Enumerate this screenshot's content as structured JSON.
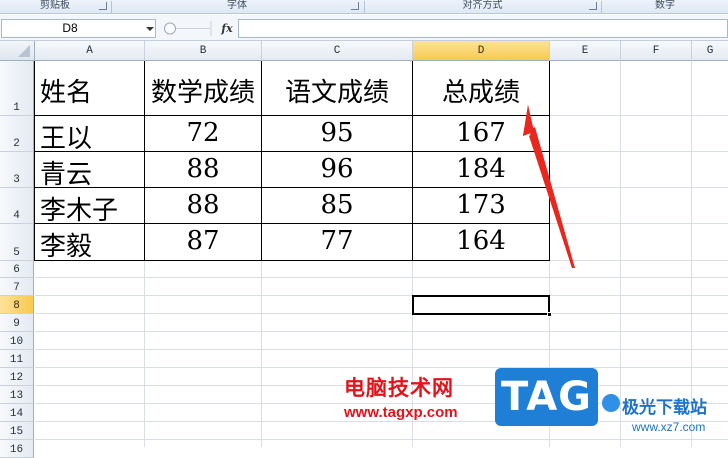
{
  "ribbon": {
    "groups": [
      "剪贴板",
      "字体",
      "对齐方式",
      "数字"
    ]
  },
  "formula_bar": {
    "name_box": "D8",
    "fx_label": "fx",
    "formula": ""
  },
  "columns": [
    "A",
    "B",
    "C",
    "D",
    "E",
    "F",
    "G"
  ],
  "selected_column": "D",
  "rows": [
    "1",
    "2",
    "3",
    "4",
    "5",
    "6",
    "7",
    "8",
    "9",
    "10",
    "11",
    "12",
    "13",
    "14",
    "15",
    "16"
  ],
  "selected_row": "8",
  "table": {
    "headers": [
      "姓名",
      "数学成绩",
      "语文成绩",
      "总成绩"
    ],
    "records": [
      [
        "王以",
        "72",
        "95",
        "167"
      ],
      [
        "青云",
        "88",
        "96",
        "184"
      ],
      [
        "李木子",
        "88",
        "85",
        "173"
      ],
      [
        "李毅",
        "87",
        "77",
        "164"
      ]
    ]
  },
  "annotation": {
    "color": "#e8281f"
  },
  "watermark": {
    "brand_cn": "电脑技术网",
    "brand_url": "www.tagxp.com",
    "tag": "TAG",
    "site_cn": "极光下载站",
    "site_url": "www.xz7.com"
  },
  "colors": {
    "selected_header": "#f7c94f",
    "grid_line": "#dadfe6",
    "watermark_red": "#e2141b",
    "watermark_blue": "#1f7ed6"
  }
}
